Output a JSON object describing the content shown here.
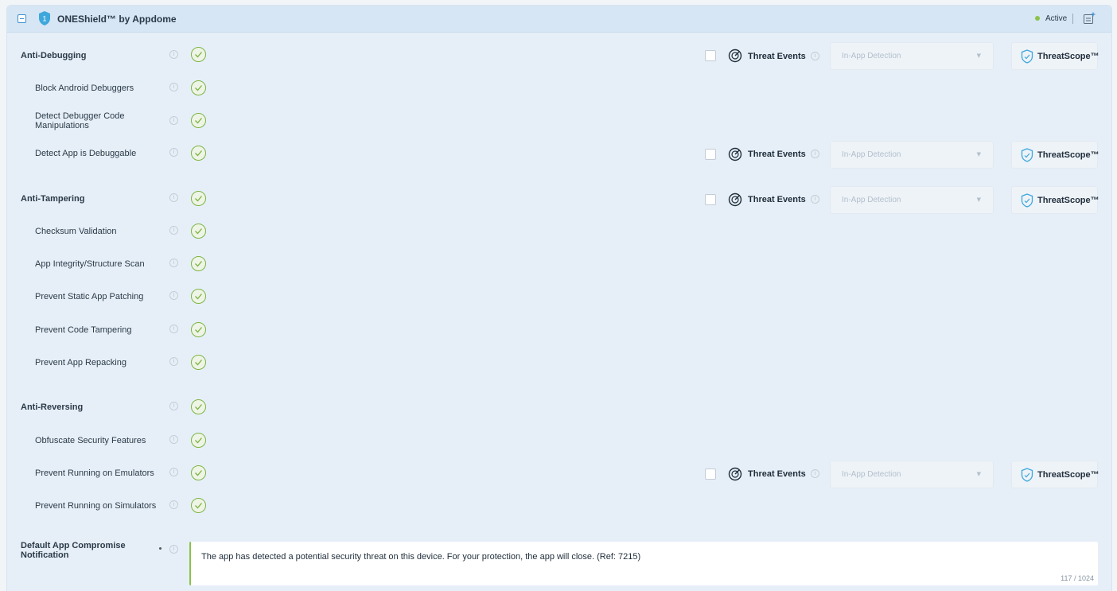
{
  "header": {
    "title": "ONEShield™ by Appdome",
    "shield_badge": "1",
    "status": "Active",
    "status_color": "#8bc34a",
    "accent": "#3e8fd0"
  },
  "features": {
    "anti_debugging": "Anti-Debugging",
    "block_android_debuggers": "Block Android Debuggers",
    "detect_debugger_code_1": "Detect Debugger Code",
    "detect_debugger_code_2": "Manipulations",
    "detect_app_debuggable": "Detect App is Debuggable",
    "anti_tampering": "Anti-Tampering",
    "checksum_validation": "Checksum Validation",
    "app_integrity": "App Integrity/Structure Scan",
    "prevent_static_patching": "Prevent Static App Patching",
    "prevent_code_tampering": "Prevent Code Tampering",
    "prevent_repacking": "Prevent App Repacking",
    "anti_reversing": "Anti-Reversing",
    "obfuscate_security": "Obfuscate Security Features",
    "prevent_emulators": "Prevent Running on Emulators",
    "prevent_simulators": "Prevent Running on Simulators"
  },
  "controls": {
    "threat_events_label": "Threat Events",
    "in_app_detection": "In-App Detection",
    "threatscope_label": "ThreatScope™",
    "info_glyph": "i",
    "caret_glyph": "▼"
  },
  "notification": {
    "label_1": "Default App Compromise",
    "label_2": "Notification",
    "message": "The app has detected a potential security threat on this device. For your protection, the app will close. (Ref: 7215)",
    "char_count": "117 / 1024"
  }
}
